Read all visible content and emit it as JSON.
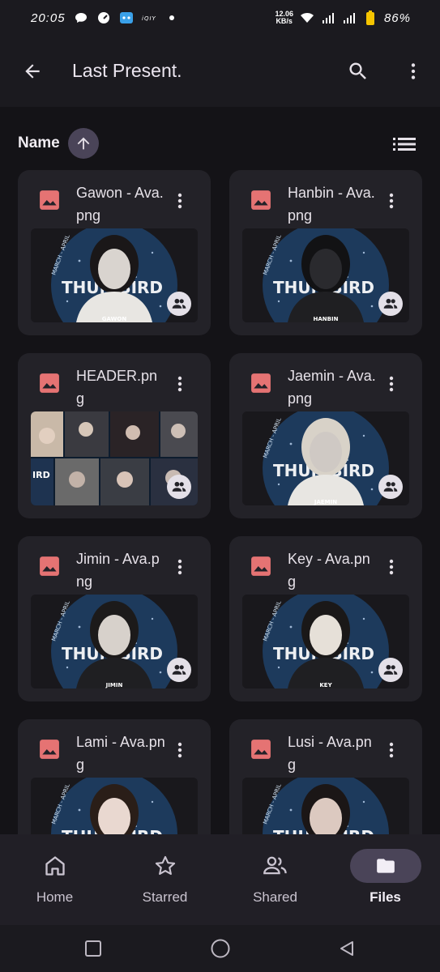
{
  "status_bar": {
    "time": "20:05",
    "net_speed_top": "12.06",
    "net_speed_unit": "KB/s",
    "battery": "86%",
    "icons": [
      "chat-bubble-icon",
      "speedometer-icon",
      "bot-icon",
      "iqiyi-icon",
      "dot-icon",
      "wifi-icon",
      "signal-icon",
      "signal-icon",
      "battery-icon"
    ]
  },
  "app_bar": {
    "title": "Last Present.",
    "back_icon": "arrow-back-icon",
    "search_icon": "search-icon",
    "more_icon": "more-vert-icon"
  },
  "sort": {
    "label": "Name",
    "direction_icon": "arrow-upward-icon",
    "view_icon": "list-view-icon"
  },
  "files": [
    {
      "name": "Gawon - Ava.png",
      "thumb": "avatar",
      "caption": "GAWON",
      "shared": true
    },
    {
      "name": "Hanbin - Ava.png",
      "thumb": "avatar",
      "caption": "HANBIN",
      "shared": true
    },
    {
      "name": "HEADER.png",
      "thumb": "collage",
      "caption": "",
      "shared": true
    },
    {
      "name": "Jaemin - Ava.png",
      "thumb": "avatar",
      "caption": "JAEMIN",
      "shared": true
    },
    {
      "name": "Jimin - Ava.png",
      "thumb": "avatar",
      "caption": "JIMIN",
      "shared": true
    },
    {
      "name": "Key - Ava.png",
      "thumb": "avatar",
      "caption": "KEY",
      "shared": true
    },
    {
      "name": "Lami - Ava.png",
      "thumb": "avatar",
      "caption": "",
      "shared": false
    },
    {
      "name": "Lusi - Ava.png",
      "thumb": "avatar",
      "caption": "",
      "shared": false
    }
  ],
  "thumb_text": {
    "banner": "THUNDERBIRD",
    "banner_short": "THUN   BIRD",
    "date_line": "MARCH - APRIL"
  },
  "bottom_nav": {
    "items": [
      {
        "label": "Home",
        "icon": "home-icon",
        "active": false
      },
      {
        "label": "Starred",
        "icon": "star-icon",
        "active": false
      },
      {
        "label": "Shared",
        "icon": "people-icon",
        "active": false
      },
      {
        "label": "Files",
        "icon": "folder-icon",
        "active": true
      }
    ]
  },
  "colors": {
    "accent_red": "#e57373",
    "pill": "#4a4458",
    "card": "#232228",
    "background": "#141317"
  }
}
